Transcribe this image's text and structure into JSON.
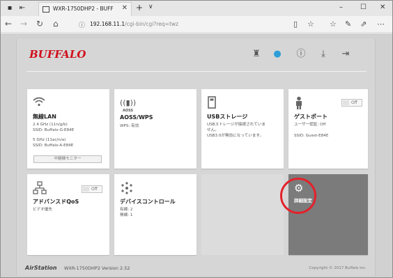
{
  "browser": {
    "tab_title": "WXR-1750DHP2 - BUFF",
    "tab_close": "✕",
    "new_tab": "+",
    "tab_menu": "∨",
    "url_host": "192.168.11.1",
    "url_path": "/cgi-bin/cgi?req=twz",
    "win_min": "–",
    "win_max": "☐",
    "win_close": "✕"
  },
  "header": {
    "logo": "BUFFALO"
  },
  "tiles": {
    "wlan": {
      "title": "無線LAN",
      "line1": "2.4 GHz (11n/g/b)",
      "line2": "SSID: Buffalo-G-E84E",
      "line3": "5 GHz (11ac/n/a)",
      "line4": "SSID: Buffalo-A-E84E",
      "button": "中継機モニター"
    },
    "aoss": {
      "icon_text": "AOSS",
      "title": "AOSS/WPS",
      "line1": "WPS: 有効"
    },
    "usb": {
      "title": "USBストレージ",
      "line1": "USBストレージが接続されていま",
      "line2": "せん。",
      "line3": "USB3.0が無効になっています。"
    },
    "guest": {
      "title": "ゲストポート",
      "toggle": "Off",
      "line1": "ユーザー認証: Off",
      "line2": "SSID: Guest-E84E"
    },
    "qos": {
      "title": "アドバンスドQoS",
      "toggle": "Off",
      "line1": "ビデオ優先"
    },
    "device": {
      "title": "デバイスコントロール",
      "line1": "有線: 2",
      "line2": "無線: 1"
    },
    "advanced": {
      "title": "詳細設定"
    }
  },
  "footer": {
    "brand": "AirStation",
    "model": "WXR-1750DHP2  Version 2.52",
    "copyright": "Copyright © 2017 Buffalo Inc."
  },
  "colors": {
    "brand_red": "#d0101b",
    "highlight_circle": "#e4212b",
    "advanced_tile": "#7b7b7b"
  }
}
